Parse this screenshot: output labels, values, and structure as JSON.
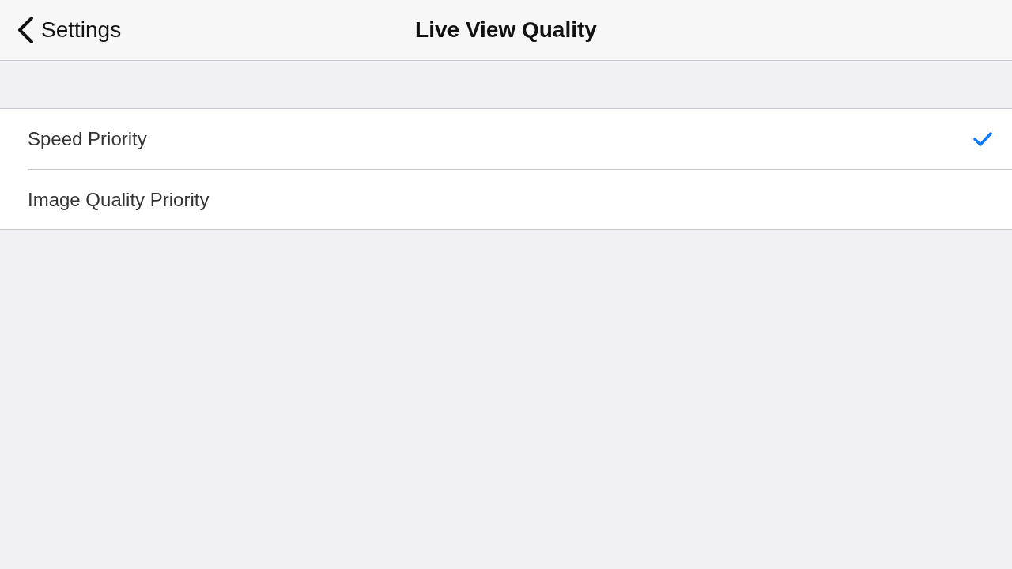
{
  "nav_bar": {
    "back_label": "Settings",
    "title": "Live View Quality"
  },
  "options": [
    {
      "label": "Speed Priority",
      "selected": true
    },
    {
      "label": "Image Quality Priority",
      "selected": false
    }
  ]
}
